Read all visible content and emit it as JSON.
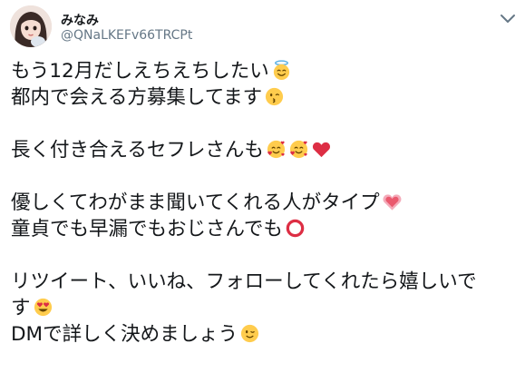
{
  "user": {
    "display_name": "みなみ",
    "handle": "@QNaLKEFv66TRCPt"
  },
  "icons": {
    "menu": "chevron-down-icon",
    "avatar": "profile-photo"
  },
  "tweet": {
    "lines": [
      {
        "text": "もう12月だしえちえちしたい",
        "emojis": [
          "smiling-face-with-halo-emoji"
        ]
      },
      {
        "text": "都内で会える方募集してます",
        "emojis": [
          "kissing-face-emoji"
        ]
      },
      {
        "text": "",
        "emojis": []
      },
      {
        "text": "長く付き合えるセフレさんも",
        "emojis": [
          "smiling-face-with-hearts-emoji",
          "smiling-face-with-hearts-emoji",
          "red-heart-emoji"
        ]
      },
      {
        "text": "",
        "emojis": []
      },
      {
        "text": "優しくてわがまま聞いてくれる人がタイプ",
        "emojis": [
          "growing-heart-emoji"
        ]
      },
      {
        "text": "童貞でも早漏でもおじさんでも",
        "emojis": [
          "hollow-red-circle-emoji"
        ]
      },
      {
        "text": "",
        "emojis": []
      },
      {
        "text": "リツイート、いいね、フォローしてくれたら嬉しいで",
        "emojis": []
      },
      {
        "text": "す",
        "emojis": [
          "heart-eyes-emoji"
        ]
      },
      {
        "text": "DMで詳しく決めましょう",
        "emojis": [
          "winking-face-emoji"
        ]
      }
    ]
  },
  "colors": {
    "name": "#14171a",
    "handle": "#657786",
    "text": "#14171a",
    "caret": "#657786"
  }
}
